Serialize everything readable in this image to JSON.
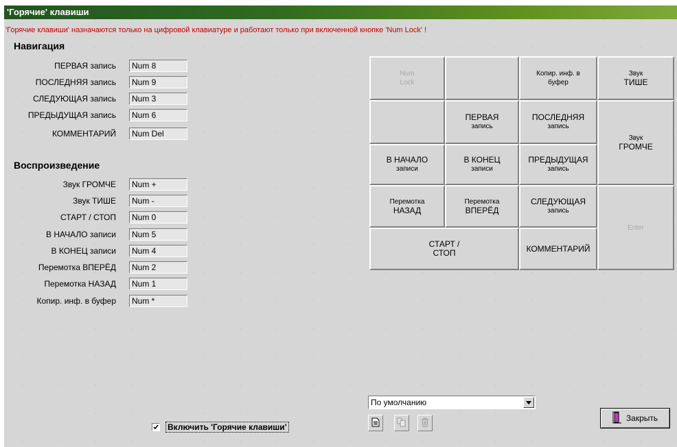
{
  "window": {
    "title": "'Горячие' клавиши"
  },
  "warning": "'Горячие клавиши' назначаются только на цифровой клавиатуре и работают только при включенной кнопке 'Num Lock' !",
  "navigation": {
    "title": "Навигация",
    "rows": [
      {
        "label": "ПЕРВАЯ запись",
        "value": "Num 8"
      },
      {
        "label": "ПОСЛЕДНЯЯ запись",
        "value": "Num 9"
      },
      {
        "label": "СЛЕДУЮЩАЯ запись",
        "value": "Num 3"
      },
      {
        "label": "ПРЕДЫДУЩАЯ запись",
        "value": "Num 6"
      },
      {
        "label": "КОММЕНТАРИЙ",
        "value": "Num Del"
      }
    ]
  },
  "playback": {
    "title": "Воспроизведение",
    "rows": [
      {
        "label": "Звук ГРОМЧЕ",
        "value": "Num +"
      },
      {
        "label": "Звук ТИШЕ",
        "value": "Num -"
      },
      {
        "label": "СТАРТ / СТОП",
        "value": "Num 0"
      },
      {
        "label": "В НАЧАЛО записи",
        "value": "Num 5"
      },
      {
        "label": "В КОНЕЦ записи",
        "value": "Num 4"
      },
      {
        "label": "Перемотка ВПЕРЁД",
        "value": "Num 2"
      },
      {
        "label": "Перемотка НАЗАД",
        "value": "Num 1"
      },
      {
        "label": "Копир. инф. в буфер",
        "value": "Num *"
      }
    ]
  },
  "keypad": {
    "numlock": [
      "Num",
      "Lock"
    ],
    "copy": [
      "Копир. инф. в",
      "буфер"
    ],
    "vol_down": [
      "Звук",
      "ТИШЕ"
    ],
    "first": [
      "ПЕРВАЯ",
      "запись"
    ],
    "last": [
      "ПОСЛЕДНЯЯ",
      "запись"
    ],
    "vol_up": [
      "Звук",
      "ГРОМЧЕ"
    ],
    "to_start": [
      "В НАЧАЛО",
      "записи"
    ],
    "to_end": [
      "В КОНЕЦ",
      "записи"
    ],
    "prev": [
      "ПРЕДЫДУЩАЯ",
      "запись"
    ],
    "rewind": [
      "Перемотка",
      "НАЗАД"
    ],
    "forward": [
      "Перемотка",
      "ВПЕРЁД"
    ],
    "next": [
      "СЛЕДУЮЩАЯ",
      "запись"
    ],
    "enter": "Enter",
    "start_stop": [
      "СТАРТ /",
      "СТОП"
    ],
    "comment": "КОММЕНТАРИЙ"
  },
  "preset": {
    "selected": "По умолчанию"
  },
  "toggle": {
    "label": "Включить 'Горячие клавиши'",
    "checked": true
  },
  "close_button": {
    "label": "Закрыть"
  }
}
